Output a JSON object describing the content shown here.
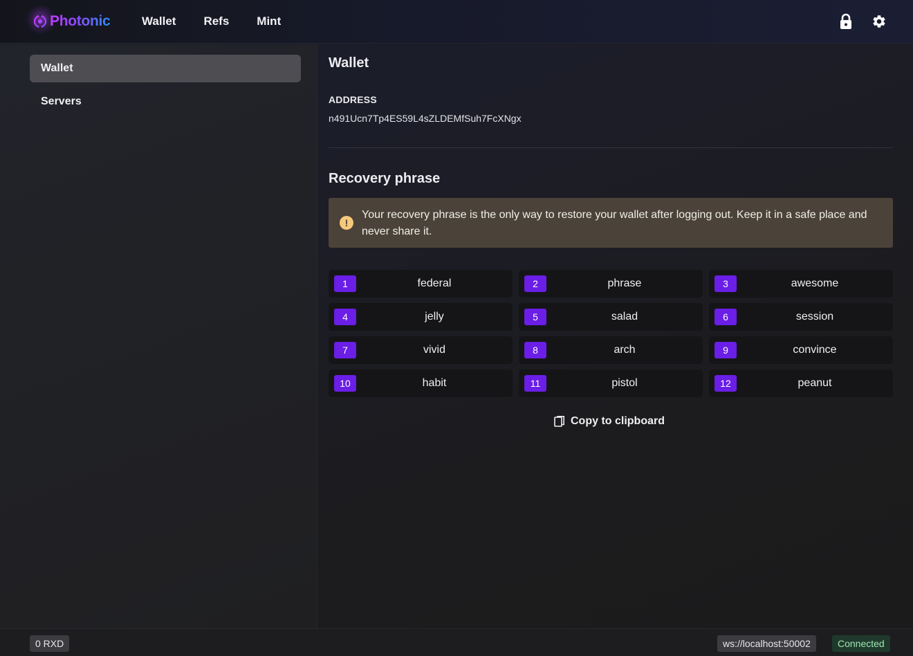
{
  "app": {
    "name": "Photonic",
    "brand_gradient": [
      "#c13cff",
      "#8a4dff",
      "#2c8cf6"
    ]
  },
  "nav": [
    {
      "label": "Wallet"
    },
    {
      "label": "Refs"
    },
    {
      "label": "Mint"
    }
  ],
  "header_icons": [
    "lock-icon",
    "gear-icon"
  ],
  "sidebar": {
    "items": [
      {
        "label": "Wallet",
        "active": true
      },
      {
        "label": "Servers",
        "active": false
      }
    ]
  },
  "main": {
    "title": "Wallet",
    "address_label": "ADDRESS",
    "address": "n491Ucn7Tp4ES59L4sZLDEMfSuh7FcXNgx",
    "recovery_title": "Recovery phrase",
    "alert_text": "Your recovery phrase is the only way to restore your wallet after logging out. Keep it in a safe place and never share it.",
    "alert_icon": "warning-icon",
    "words": [
      {
        "num": "1",
        "word": "federal"
      },
      {
        "num": "2",
        "word": "phrase"
      },
      {
        "num": "3",
        "word": "awesome"
      },
      {
        "num": "4",
        "word": "jelly"
      },
      {
        "num": "5",
        "word": "salad"
      },
      {
        "num": "6",
        "word": "session"
      },
      {
        "num": "7",
        "word": "vivid"
      },
      {
        "num": "8",
        "word": "arch"
      },
      {
        "num": "9",
        "word": "convince"
      },
      {
        "num": "10",
        "word": "habit"
      },
      {
        "num": "11",
        "word": "pistol"
      },
      {
        "num": "12",
        "word": "peanut"
      }
    ],
    "copy_label": "Copy to clipboard",
    "copy_icon": "copy-icon"
  },
  "footer": {
    "balance": "0 RXD",
    "server": "ws://localhost:50002",
    "status": "Connected"
  },
  "colors": {
    "accent": "#6a1ee6",
    "alert_bg": "#4b4339",
    "alert_icon": "#f6c97a",
    "status_green": "#9fe6b0"
  }
}
